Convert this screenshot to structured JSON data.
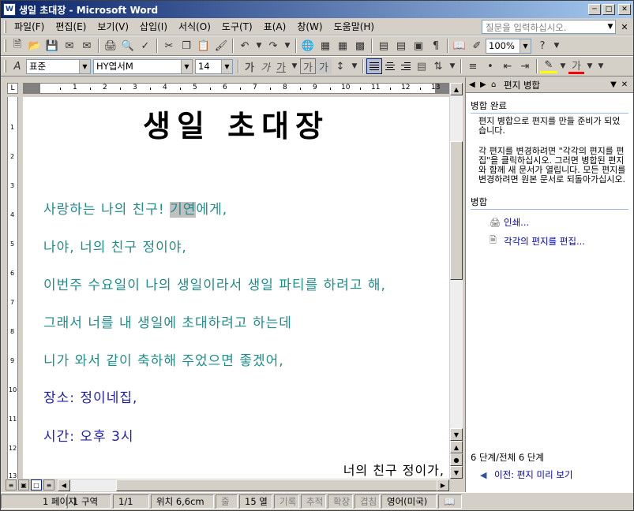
{
  "window": {
    "app_icon": "word-icon",
    "title": "생일 초대장 - Microsoft Word"
  },
  "menu": [
    "파일(F)",
    "편집(E)",
    "보기(V)",
    "삽입(I)",
    "서식(O)",
    "도구(T)",
    "표(A)",
    "창(W)",
    "도움말(H)"
  ],
  "help_placeholder": "질문을 입력하십시오.",
  "toolbar": {
    "zoom": "100%"
  },
  "format": {
    "style": "표준",
    "font": "HY엽서M",
    "size": "14",
    "bold": "가",
    "italic": "가",
    "underline": "가",
    "border_char": "가",
    "shade_char": "가",
    "font_color": "가"
  },
  "ruler": {
    "numbers": [
      "1",
      "2",
      "3",
      "4",
      "5",
      "6",
      "7",
      "8",
      "9",
      "10",
      "11",
      "12",
      "13"
    ],
    "v_numbers": [
      "1",
      "2",
      "3",
      "4",
      "5",
      "6",
      "7",
      "8",
      "9",
      "10",
      "11",
      "12",
      "13"
    ]
  },
  "document": {
    "title": "생일 초대장",
    "line1_pre": "사랑하는 나의 친구! ",
    "line1_field": "기연",
    "line1_post": "에게,",
    "line2": "나야, 너의 친구 정이야,",
    "line3": "이번주 수요일이 나의 생일이라서 생일 파티를 하려고 해,",
    "line4": "그래서 너를 내 생일에 초대하려고 하는데",
    "line5": "니가 와서 같이 축하해 주었으면 좋겠어,",
    "line6": "장소: 정이네집,",
    "line7": "시간: 오후 3시",
    "signature": "너의 친구 정이가,"
  },
  "pane": {
    "title": "편지 병합",
    "done_header": "병합 완료",
    "done_text": "편지 병합으로 편지를 만들 준비가 되었습니다.",
    "edit_text": "각 편지를 변경하려면 \"각각의 편지를 편집\"을 클릭하십시오. 그러면 병합된 편지와 함께 새 문서가 열립니다. 모든 편지를 변경하려면 원본 문서로 되돌아가십시오.",
    "merge_header": "병합",
    "print_link": "인쇄...",
    "edit_link": "각각의 편지를 편집...",
    "steps": "6 단계/전체  6 단계",
    "prev_link": "이전: 편지 미리 보기"
  },
  "status": {
    "page": "1 페이지",
    "section": "1 구역",
    "page_count": "1/1",
    "position": "위치 6,6cm",
    "line": "줄",
    "column": "15 열",
    "rec": "기록",
    "trk": "추적",
    "ext": "확장",
    "ovr": "겹침",
    "lang": "영어(미국)"
  }
}
